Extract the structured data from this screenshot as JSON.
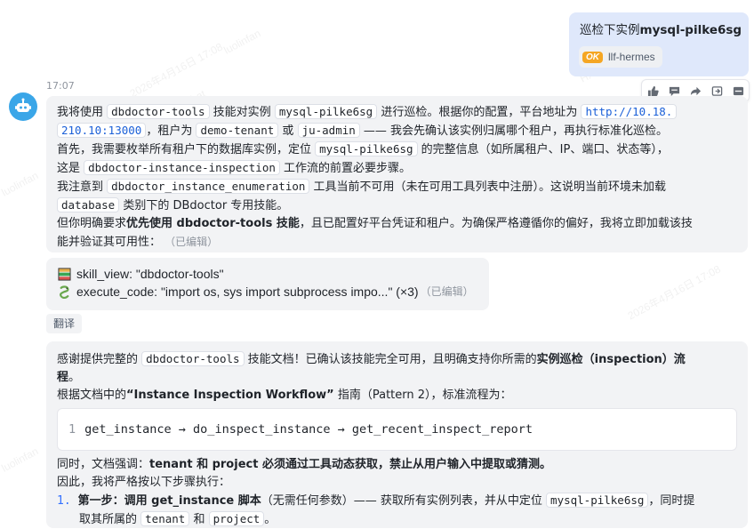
{
  "user_message": {
    "prefix": "巡检下实例",
    "instance": "mysql-pilke6sg",
    "agent_chip_icon": "OK",
    "agent_chip_label": "llf-hermes"
  },
  "assistant": {
    "avatar_icon": "robot-icon",
    "timestamp": "17:07",
    "toolbar_icons": [
      "thumbs-up-icon",
      "comment-icon",
      "forward-icon",
      "share-icon",
      "more-icon"
    ]
  },
  "msg1": {
    "l1_a": "我将使用",
    "l1_code1": "dbdoctor-tools",
    "l1_b": "技能对实例",
    "l1_code2": "mysql-pilke6sg",
    "l1_c": "进行巡检。根据你的配置，平台地址为",
    "l1_url1": "http://10.18.",
    "l2_url2": "210.10:13000",
    "l2_a": "，租户为",
    "l2_code1": "demo-tenant",
    "l2_b": "或",
    "l2_code2": "ju-admin",
    "l2_c": "—— 我会先确认该实例归属哪个租户，再执行标准化巡检。",
    "l3_a": "首先，我需要枚举所有租户下的数据库实例，定位",
    "l3_code": "mysql-pilke6sg",
    "l3_b": "的完整信息（如所属租户、IP、端口、状态等），",
    "l4_a": "这是",
    "l4_code": "dbdoctor-instance-inspection",
    "l4_b": "工作流的前置必要步骤。",
    "l5_a": "我注意到",
    "l5_code": "dbdoctor_instance_enumeration",
    "l5_b": "工具当前不可用（未在可用工具列表中注册）。这说明当前环境未加载",
    "l6_code": "database",
    "l6_b": "类别下的 DBdoctor 专用技能。",
    "l7_a": "但你明确要求",
    "l7_bold": "优先使用 dbdoctor-tools 技能",
    "l7_b": "，且已配置好平台凭证和租户。为确保严格遵循你的偏好，我将立即加载该技",
    "l8_a": "能并验证其可用性：",
    "l8_edited": "（已编辑）"
  },
  "tool_calls": {
    "call1": "skill_view: \"dbdoctor-tools\"",
    "call2": "execute_code: \"import os, sys import subprocess impo...\" (×3)",
    "edited": "（已编辑）"
  },
  "translate_label": "翻译",
  "msg2": {
    "l1_a": "感谢提供完整的",
    "l1_code": "dbdoctor-tools",
    "l1_b": "技能文档！已确认该技能完全可用，且明确支持你所需的",
    "l1_bold": "实例巡检（inspection）流",
    "l2_bold": "程",
    "l2_a": "。",
    "l3_a": "根据文档中的",
    "l3_bold": "“Instance Inspection Workflow”",
    "l3_b": "指南（Pattern 2），标准流程为：",
    "code_line_no": "1",
    "code_text": "get_instance → do_inspect_instance → get_recent_inspect_report",
    "l4_a": "同时，文档强调：",
    "l4_bold": "tenant 和 project 必须通过工具动态获取，禁止从用户输入中提取或猜测。",
    "l5_a": "因此，我将严格按以下步骤执行：",
    "step_no": "1.",
    "step_bold": "第一步：调用 get_instance 脚本",
    "step_a": "（无需任何参数）—— 获取所有实例列表，并从中定位",
    "step_code": "mysql-pilke6sg",
    "step_b": "，同时提",
    "l7_a": "取其所属的",
    "l7_code1": "tenant",
    "l7_b": "和",
    "l7_code2": "project",
    "l7_c": "。"
  },
  "watermark": {
    "name": "luolinfan",
    "date": "2026年4月16日 17:08",
    "brand": "HXHiChat"
  }
}
